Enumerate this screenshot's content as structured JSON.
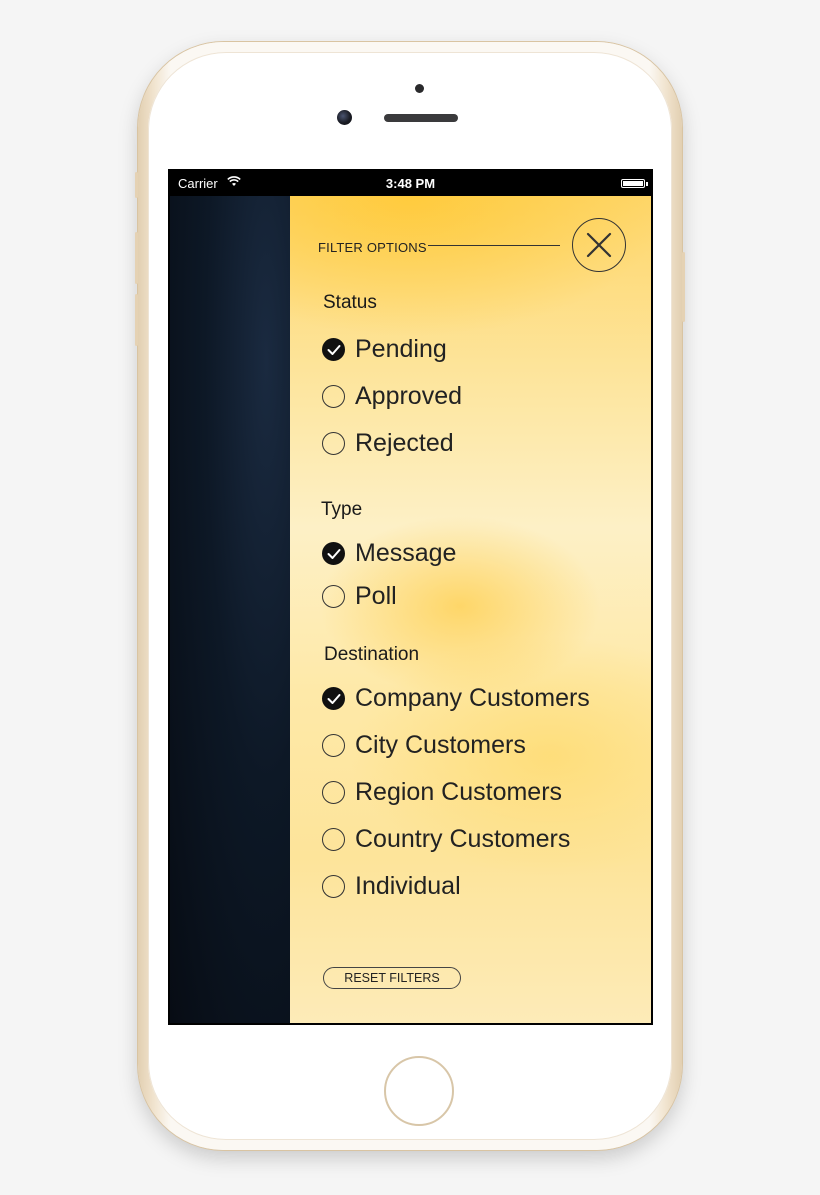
{
  "status_bar": {
    "carrier": "Carrier",
    "time": "3:48 PM"
  },
  "drawer": {
    "header": "FILTER OPTIONS",
    "close_icon": "close-x-icon",
    "sections": {
      "status": {
        "title": "Status",
        "options": [
          {
            "label": "Pending",
            "checked": true
          },
          {
            "label": "Approved",
            "checked": false
          },
          {
            "label": "Rejected",
            "checked": false
          }
        ]
      },
      "type": {
        "title": "Type",
        "options": [
          {
            "label": "Message",
            "checked": true
          },
          {
            "label": "Poll",
            "checked": false
          }
        ]
      },
      "destination": {
        "title": "Destination",
        "options": [
          {
            "label": "Company Customers",
            "checked": true
          },
          {
            "label": "City Customers",
            "checked": false
          },
          {
            "label": "Region Customers",
            "checked": false
          },
          {
            "label": "Country Customers",
            "checked": false
          },
          {
            "label": "Individual",
            "checked": false
          }
        ]
      }
    },
    "reset_label": "RESET FILTERS"
  },
  "colors": {
    "drawer_yellow": "#fed66a",
    "panel_navy": "#0d1826",
    "phone_gold": "#e2cfb1"
  }
}
